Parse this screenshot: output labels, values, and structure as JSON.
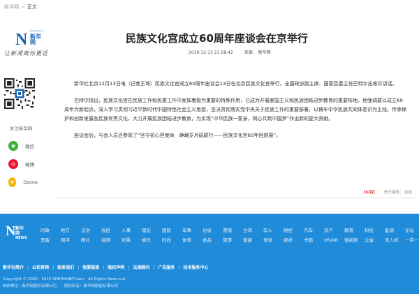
{
  "breadcrumb": {
    "home": "新华网",
    "separator": ">",
    "current": "正文"
  },
  "logo": {
    "small": "www.news.cn",
    "cn": "新华网",
    "slogan": "让新闻离你更近"
  },
  "article": {
    "title": "民族文化宫成立60周年座谈会在京举行",
    "datetime": "2019-12-13 21:58:42",
    "source": "来源： 新华网",
    "paragraphs": [
      "新华社北京12月13日电（记者王琦）民族文化宫成立60周年座谈会13日在北京民族文化宫举行。全国政协副主席、国家民委主任巴特尔出席并讲话。",
      "巴特尔指出，民族文化宫在民族工作和民委工作中发挥着极为重要的特殊作用，已成为开展爱国主义和民族团结进步教育的重要阵地。他强调要以成立60周年为新起点，深入学习贯彻习近平新时代中国特色社会主义思想，坚决贯彻落实党中央关于民族工作的重要部署，以铸牢中华民族共同体意识为主线，传承保护和创新发展各民族优秀文化，大力开展民族团结进步教育，为实现“中华民族一家亲，同心共筑中国梦”作出新的更大贡献。",
      "座谈会后，与会人员还参观了“坚守初心担使命　峥嵘岁月砥砺行——民族文化宫60年回顾展”。"
    ],
    "tag": "【纠错】",
    "editor": "责任编辑： 张圆"
  },
  "sidebar": {
    "follow_label": "关注新华网",
    "shares": [
      {
        "label": "微信",
        "icon": "wechat-icon",
        "color": "#3cb034",
        "glyph": "◉"
      },
      {
        "label": "微博",
        "icon": "weibo-icon",
        "color": "#e6162d",
        "glyph": "◎"
      },
      {
        "label": "Qzone",
        "icon": "qzone-icon",
        "color": "#f5b30b",
        "glyph": "★"
      }
    ]
  },
  "footer": {
    "logo": {
      "cn": "新华网",
      "en": "NEWS"
    },
    "nav_row1": [
      "时政",
      "地方",
      "法治",
      "高层",
      "人事",
      "理论",
      "国际",
      "军事",
      "访谈",
      "港澳",
      "台湾",
      "华人",
      "财经",
      "汽车",
      "房产",
      "教育",
      "科技",
      "能源",
      "论坛"
    ],
    "nav_row2": [
      "思客",
      "网评",
      "图片",
      "视频",
      "彩票",
      "娱乐",
      "时尚",
      "体育",
      "食品",
      "旅游",
      "健康",
      "悦读",
      "视界",
      "书画",
      "VR/AR",
      "微视频",
      "公益",
      "无人机",
      "一带一路"
    ],
    "links": [
      "新华社简介",
      "公司官网",
      "联系我们",
      "我要链接",
      "版权声明",
      "法律顾问",
      "广告服务",
      "技术服务中心"
    ],
    "copyright": "Copyright © 2000 - 2019 XINHUANET.com　All Rights Reserved.",
    "producer": "制作单位：新华网股份有限公司　　版权所有：新华网股份有限公司"
  },
  "colors": {
    "brand": "#1a64b4",
    "footer_bg": "#1f8bd9"
  }
}
